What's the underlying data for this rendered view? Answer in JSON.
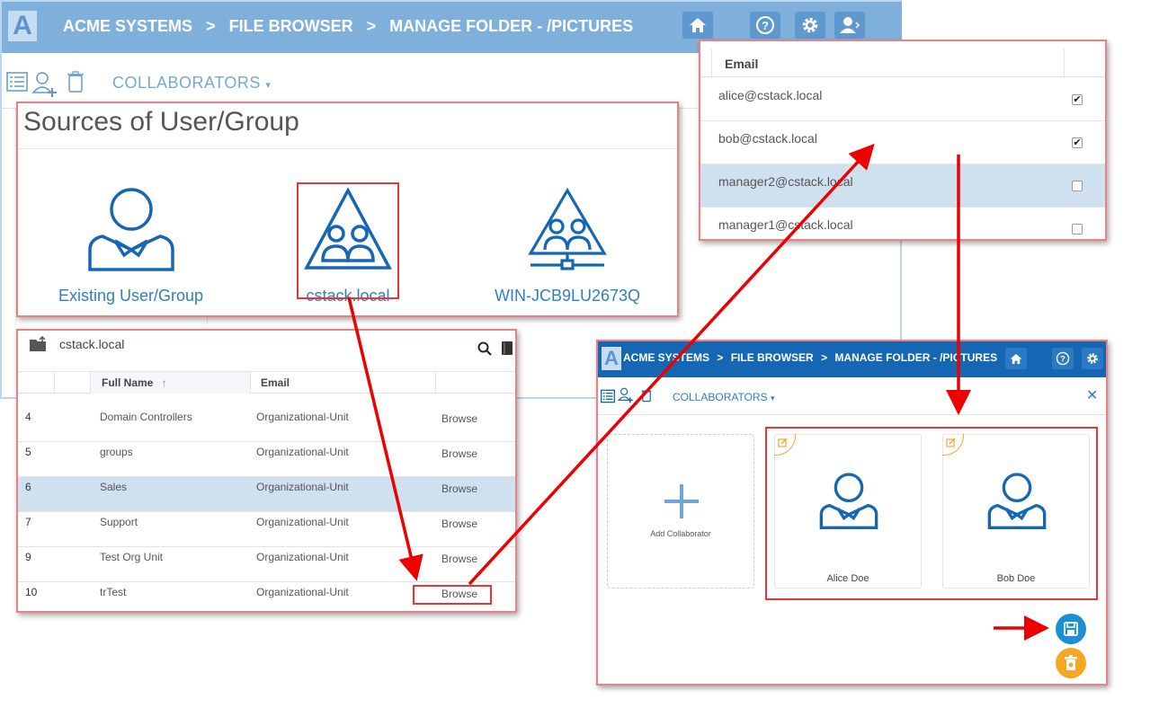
{
  "app": {
    "logo_letter": "A",
    "breadcrumbs": [
      "ACME SYSTEMS",
      ">",
      "FILE BROWSER",
      ">",
      "MANAGE FOLDER - /PICTURES"
    ],
    "toolbar_dropdown": "COLLABORATORS"
  },
  "sources": {
    "title": "Sources of User/Group",
    "items": [
      {
        "label": "Existing User/Group",
        "icon": "user-icon"
      },
      {
        "label": "cstack.local",
        "icon": "domain-group-icon"
      },
      {
        "label": "WIN-JCB9LU2673Q",
        "icon": "network-group-icon"
      }
    ]
  },
  "emails": {
    "column_header": "Email",
    "rows": [
      {
        "email": "alice@cstack.local",
        "checked": true
      },
      {
        "email": "bob@cstack.local",
        "checked": true
      },
      {
        "email": "manager2@cstack.local",
        "checked": false
      },
      {
        "email": "manager1@cstack.local",
        "checked": false
      }
    ]
  },
  "directory": {
    "title": "cstack.local",
    "columns": [
      "Full Name",
      "Email"
    ],
    "rows": [
      {
        "num": "4",
        "name": "Domain Controllers",
        "email": "Organizational-Unit",
        "action": "Browse"
      },
      {
        "num": "5",
        "name": "groups",
        "email": "Organizational-Unit",
        "action": "Browse"
      },
      {
        "num": "6",
        "name": "Sales",
        "email": "Organizational-Unit",
        "action": "Browse"
      },
      {
        "num": "7",
        "name": "Support",
        "email": "Organizational-Unit",
        "action": "Browse"
      },
      {
        "num": "9",
        "name": "Test Org Unit",
        "email": "Organizational-Unit",
        "action": "Browse"
      },
      {
        "num": "10",
        "name": "trTest",
        "email": "Organizational-Unit",
        "action": "Browse"
      }
    ]
  },
  "result": {
    "breadcrumbs": [
      "ACME SYSTEMS",
      ">",
      "FILE BROWSER",
      ">",
      "MANAGE FOLDER - /PICTURES"
    ],
    "toolbar_dropdown": "COLLABORATORS",
    "close_glyph": "✕",
    "add_label": "Add Collaborator",
    "collaborators": [
      "Alice Doe",
      "Bob Doe"
    ]
  },
  "colors": {
    "header_bg": "#7fb0dc",
    "new_header_bg": "#1667b3",
    "accent_blue": "#2f7ec2",
    "highlight_red": "#e33",
    "save_button": "#1d8fd6",
    "discard_button": "#f5a623"
  }
}
